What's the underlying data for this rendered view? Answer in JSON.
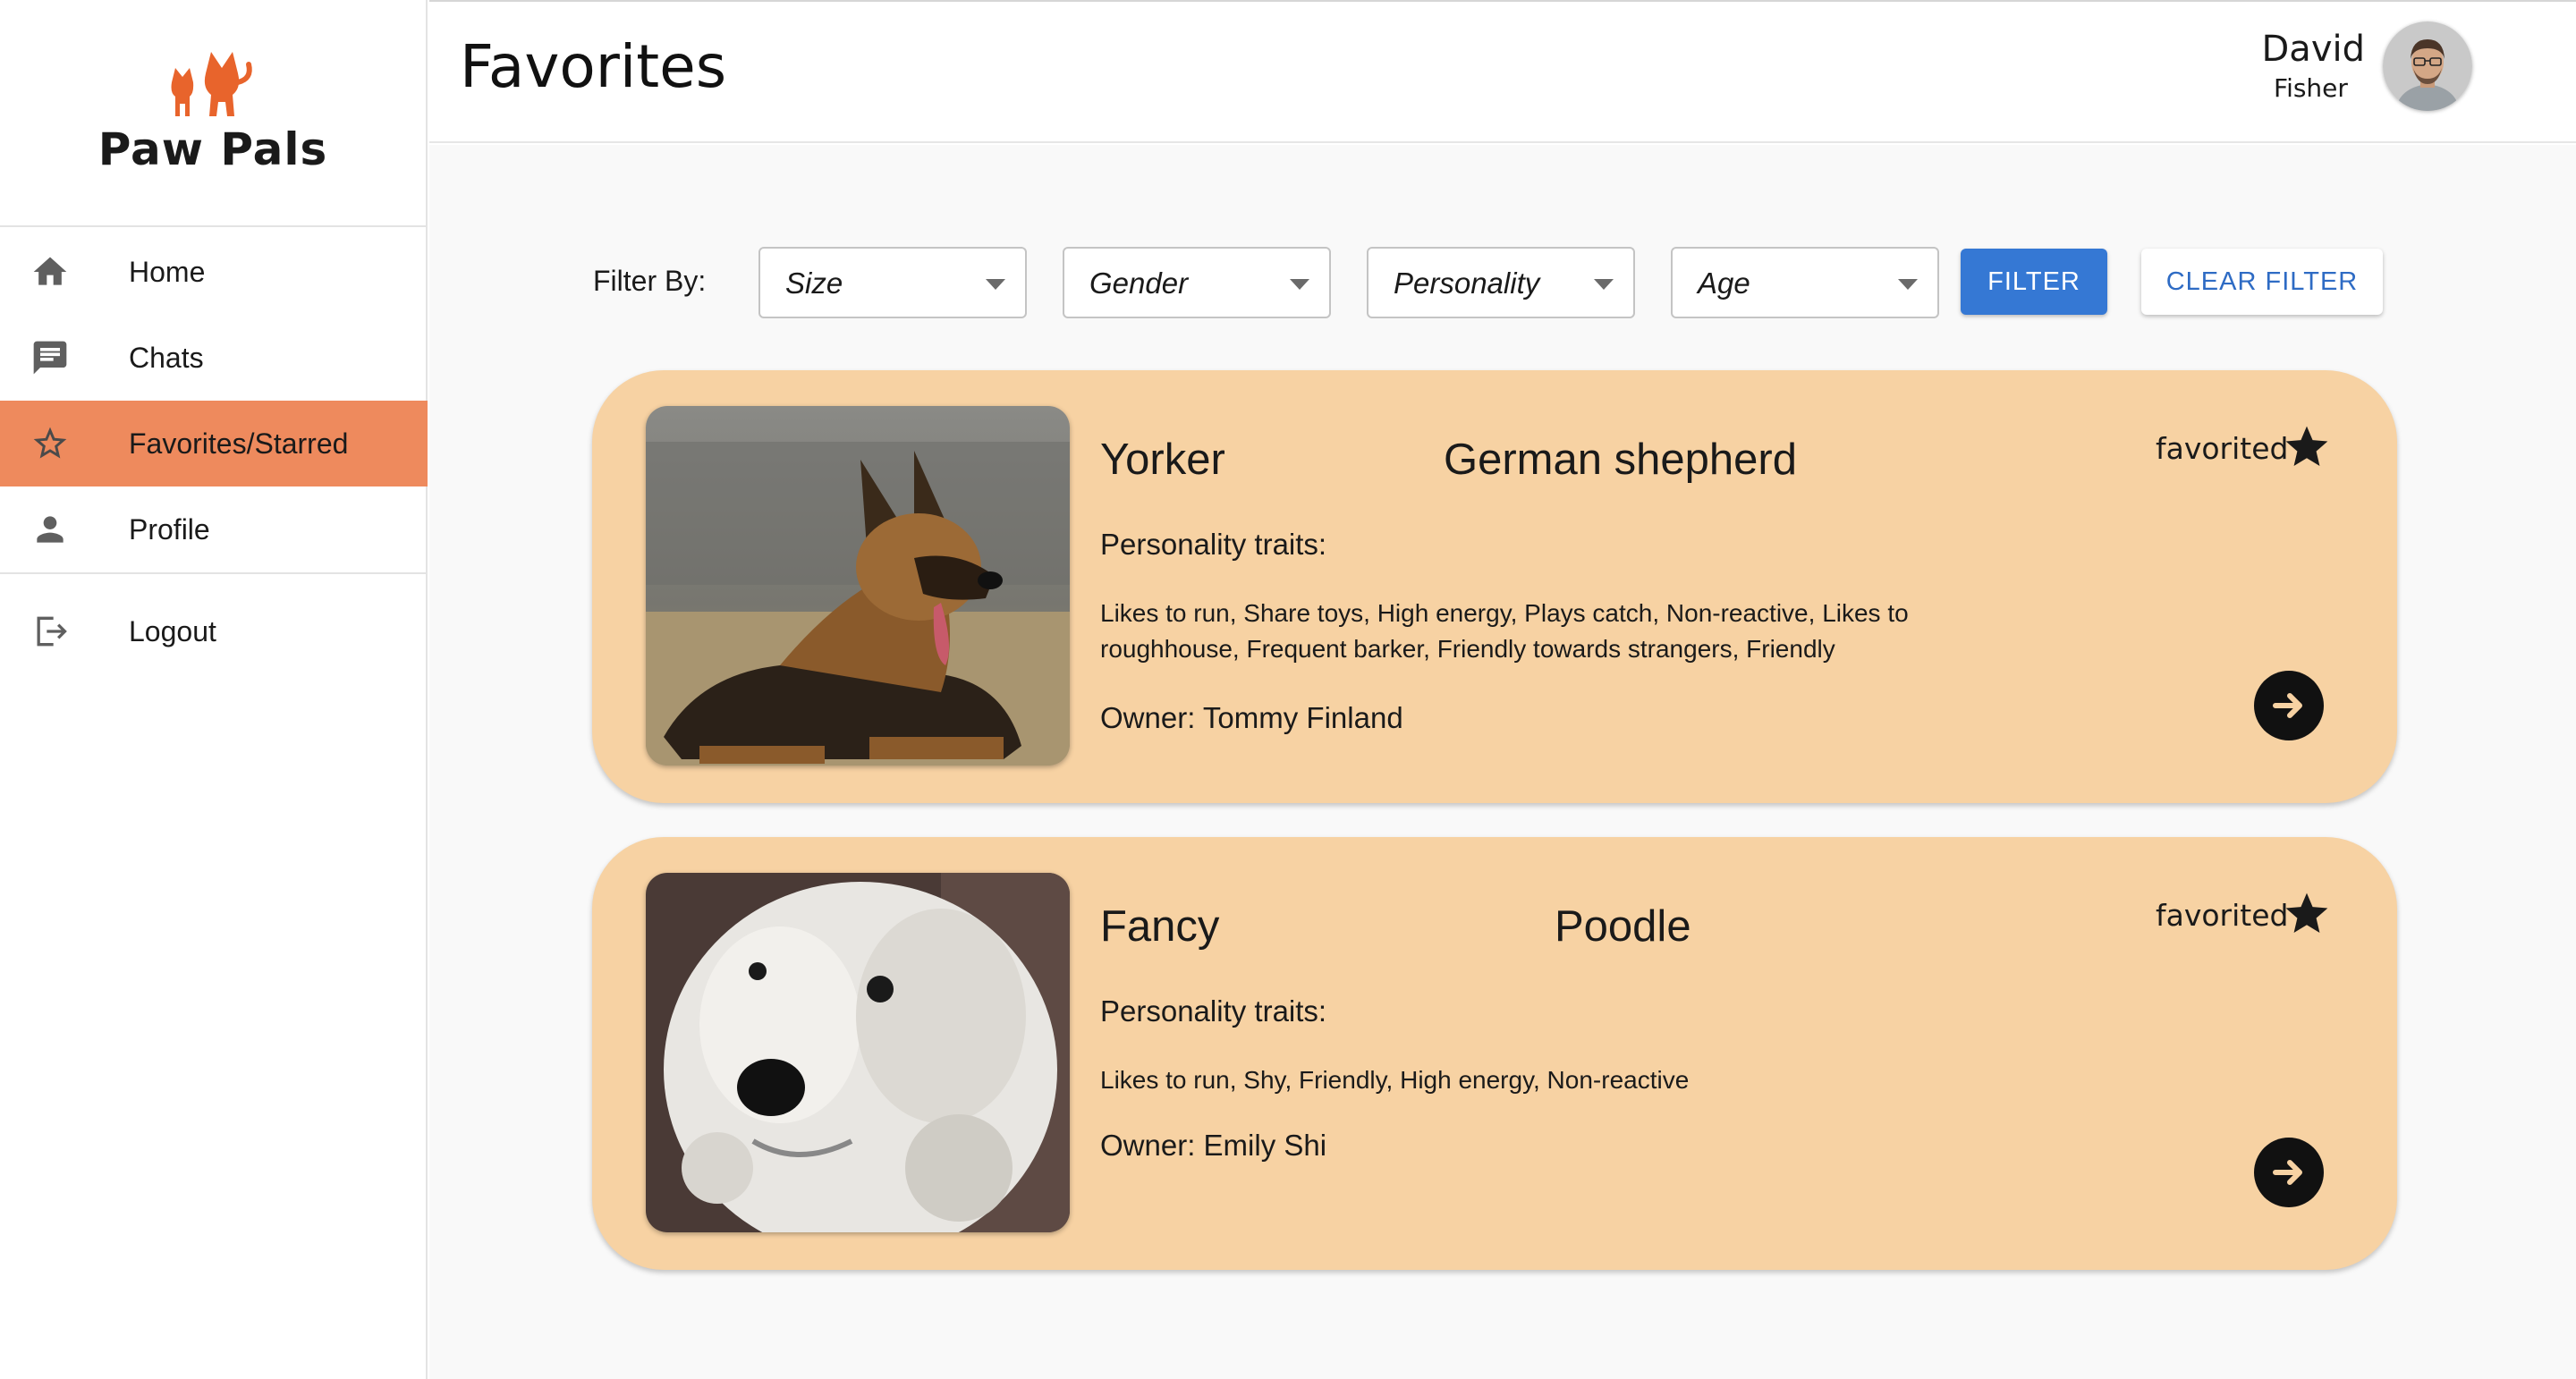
{
  "app": {
    "name": "Paw Pals",
    "accent": "#ee8a5d",
    "card_color": "#f7d2a3",
    "primary": "#3578d4"
  },
  "sidebar": {
    "items": [
      {
        "label": "Home",
        "icon": "home-icon"
      },
      {
        "label": "Chats",
        "icon": "chat-icon"
      },
      {
        "label": "Favorites/Starred",
        "icon": "star-outline-icon",
        "active": true
      },
      {
        "label": "Profile",
        "icon": "person-icon"
      },
      {
        "label": "Logout",
        "icon": "logout-icon"
      }
    ]
  },
  "header": {
    "title": "Favorites",
    "user": {
      "first_name": "David",
      "last_name": "Fisher"
    }
  },
  "filters": {
    "label": "Filter By:",
    "selects": [
      {
        "value": "Size"
      },
      {
        "value": "Gender"
      },
      {
        "value": "Personality"
      },
      {
        "value": "Age"
      }
    ],
    "filter_button": "FILTER",
    "clear_button": "CLEAR FILTER"
  },
  "cards": [
    {
      "name": "Yorker",
      "breed": "German shepherd",
      "traits_heading": "Personality traits:",
      "traits": "Likes to run, Share toys, High energy, Plays catch, Non-reactive, Likes to roughhouse, Frequent barker, Friendly towards strangers, Friendly",
      "owner": "Owner: Tommy Finland",
      "favorited_label": "favorited",
      "photo": "german-shepherd-photo"
    },
    {
      "name": "Fancy",
      "breed": "Poodle",
      "traits_heading": "Personality traits:",
      "traits": "Likes to run, Shy, Friendly, High energy, Non-reactive",
      "owner": "Owner: Emily Shi",
      "favorited_label": "favorited",
      "photo": "poodle-photo"
    }
  ]
}
